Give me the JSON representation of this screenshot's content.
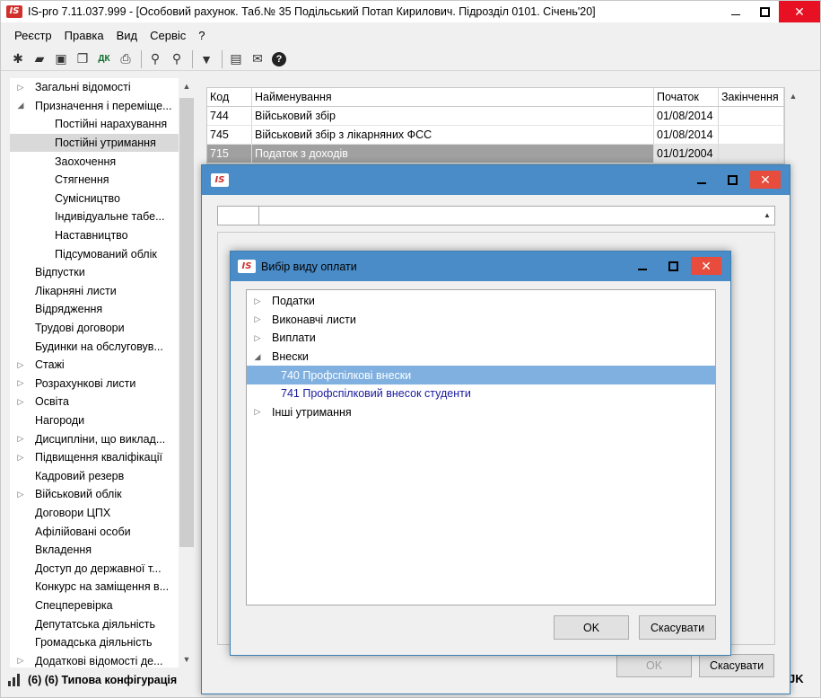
{
  "window": {
    "logo": "IS",
    "title": "IS-pro 7.11.037.999 - [Особовий рахунок. Таб.№ 35 Подільський Потап Кирилович. Підрозділ 0101. Січень'20]"
  },
  "menu": [
    "Реєстр",
    "Правка",
    "Вид",
    "Сервіс",
    "?"
  ],
  "toolbar_icons": [
    "new-icon",
    "edit-icon",
    "copy-group-icon",
    "duplicate-icon",
    "dk-icon",
    "print-icon",
    "find-icon",
    "find-next-icon",
    "filter-icon",
    "document-icon",
    "mail-icon",
    "help-icon"
  ],
  "toolbar_dk": "ДК",
  "tree": [
    {
      "label": "Загальні відомості",
      "state": "collapsed"
    },
    {
      "label": "Призначення і переміще...",
      "state": "expanded"
    },
    {
      "label": "Постійні нарахування",
      "child": true
    },
    {
      "label": "Постійні утримання",
      "child": true,
      "selected": true
    },
    {
      "label": "Заохочення",
      "child": true
    },
    {
      "label": "Стягнення",
      "child": true
    },
    {
      "label": "Сумісництво",
      "child": true
    },
    {
      "label": "Індивідуальне табе...",
      "child": true
    },
    {
      "label": "Наставництво",
      "child": true
    },
    {
      "label": "Підсумований облік",
      "child": true
    },
    {
      "label": "Відпустки"
    },
    {
      "label": "Лікарняні листи"
    },
    {
      "label": "Відрядження"
    },
    {
      "label": "Трудові договори"
    },
    {
      "label": "Будинки на обслуговув..."
    },
    {
      "label": "Стажі",
      "state": "collapsed"
    },
    {
      "label": "Розрахункові листи",
      "state": "collapsed"
    },
    {
      "label": "Освіта",
      "state": "collapsed"
    },
    {
      "label": "Нагороди"
    },
    {
      "label": "Дисципліни, що виклад...",
      "state": "collapsed"
    },
    {
      "label": "Підвищення кваліфікації",
      "state": "collapsed"
    },
    {
      "label": "Кадровий резерв"
    },
    {
      "label": "Військовий облік",
      "state": "collapsed"
    },
    {
      "label": "Договори ЦПХ"
    },
    {
      "label": "Афілійовані особи"
    },
    {
      "label": "Вкладення"
    },
    {
      "label": "Доступ до державної т..."
    },
    {
      "label": "Конкурс на заміщення в..."
    },
    {
      "label": "Спецперевірка"
    },
    {
      "label": "Депутатська діяльність"
    },
    {
      "label": "Громадська діяльність"
    },
    {
      "label": "Додаткові відомості де...",
      "state": "collapsed"
    }
  ],
  "status": {
    "text": "(6) (6) Типова конфігурація",
    "right": "JK"
  },
  "grid": {
    "headers": [
      "Код",
      "Найменування",
      "Початок",
      "Закінчення"
    ],
    "rows": [
      {
        "code": "744",
        "name": "Військовий збір",
        "start": "01/08/2014",
        "end": ""
      },
      {
        "code": "745",
        "name": "Військовий збір з лікарняних ФСС",
        "start": "01/08/2014",
        "end": ""
      },
      {
        "code": "715",
        "name": "Податок з доходів",
        "start": "01/01/2004",
        "end": "",
        "highlighted": true
      }
    ]
  },
  "dialog_back": {
    "ok": "OK",
    "cancel": "Скасувати"
  },
  "dialog_front": {
    "title": "Вибір виду оплати",
    "items": [
      {
        "label": "Податки",
        "state": "collapsed"
      },
      {
        "label": "Виконавчі листи",
        "state": "collapsed"
      },
      {
        "label": "Виплати",
        "state": "collapsed"
      },
      {
        "label": "Внески",
        "state": "expanded"
      },
      {
        "label": "740 Профспілкові внески",
        "child": true,
        "selected": true
      },
      {
        "label": "741 Профспілковий внесок  студенти",
        "child": true
      },
      {
        "label": "Інші утримання",
        "state": "collapsed"
      }
    ],
    "ok": "OK",
    "cancel": "Скасувати"
  }
}
